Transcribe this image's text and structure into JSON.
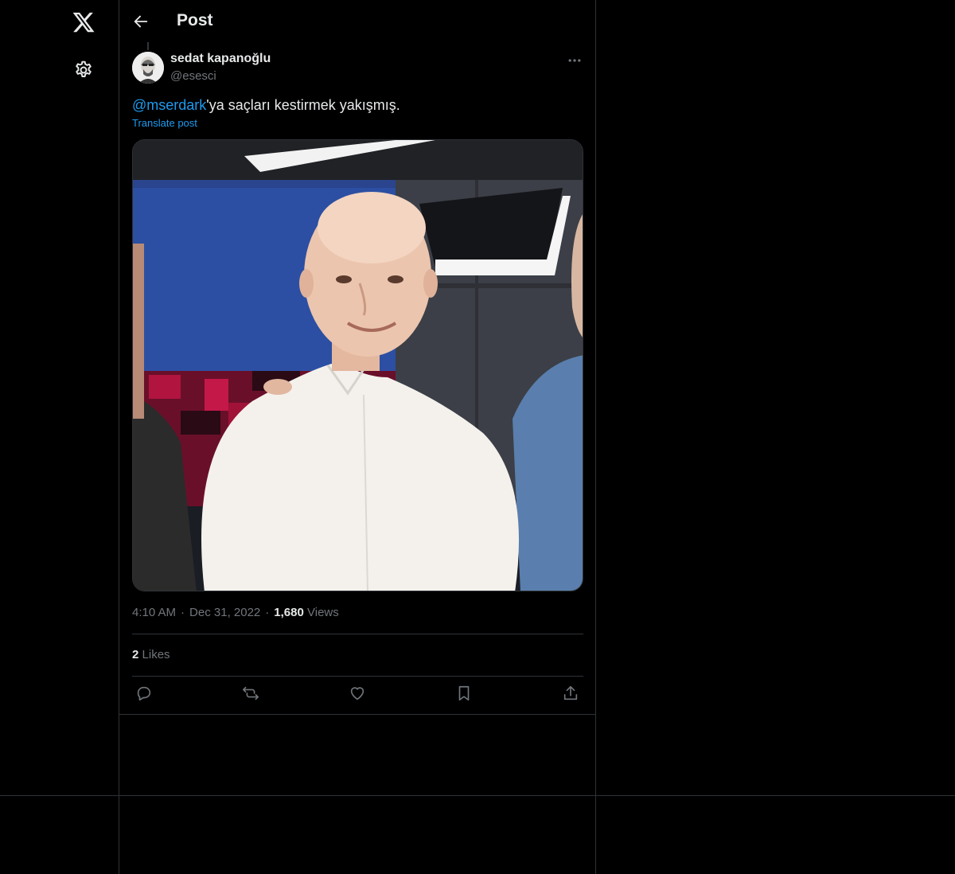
{
  "header": {
    "title": "Post"
  },
  "post": {
    "author_name": "sedat kapanoğlu",
    "author_handle": "@esesci",
    "mention": "@mserdark",
    "text_rest": "'ya saçları kestirmek yakışmış.",
    "translate_label": "Translate post",
    "time": "4:10 AM",
    "date": "Dec 31, 2022",
    "views_count": "1,680",
    "views_label": "Views",
    "likes_count": "2",
    "likes_label": "Likes"
  },
  "icons": {
    "logo": "x-logo-icon",
    "settings": "gear-icon",
    "back": "arrow-left-icon",
    "more": "more-horizontal-icon",
    "reply": "reply-icon",
    "repost": "repost-icon",
    "like": "heart-icon",
    "bookmark": "bookmark-icon",
    "share": "share-icon"
  },
  "colors": {
    "background": "#000000",
    "text": "#e7e9ea",
    "secondary": "#71767b",
    "accent": "#1d9bf0",
    "border": "#2f3336"
  }
}
